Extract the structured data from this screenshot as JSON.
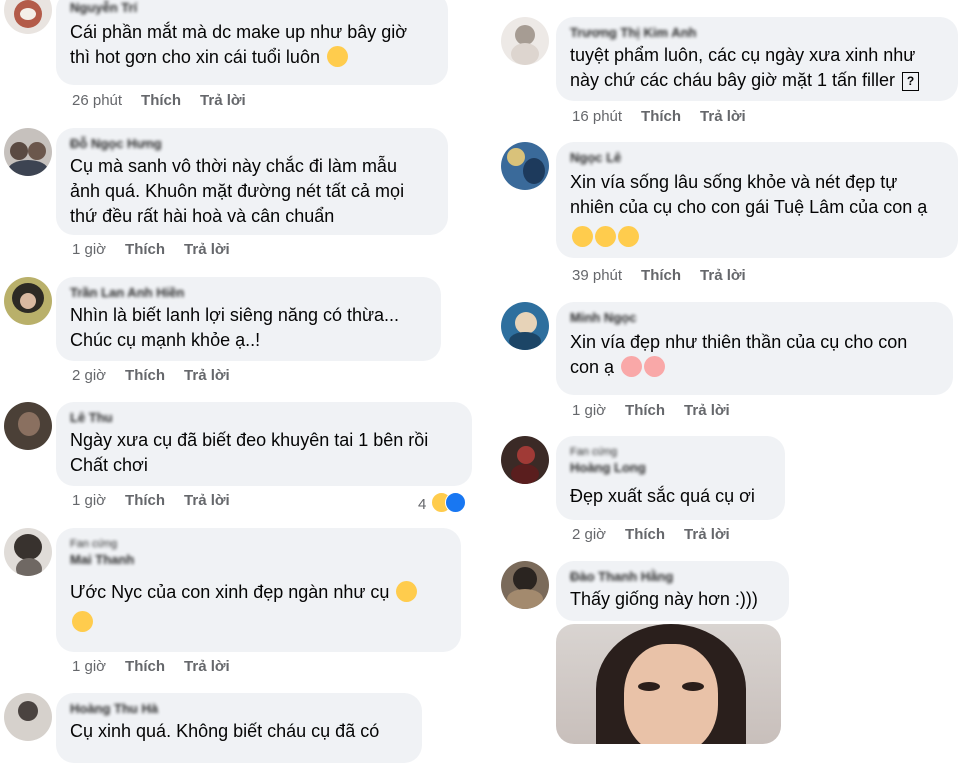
{
  "left_comments": [
    {
      "name": "Nguyễn Trí",
      "text": "Cái phần mắt mà dc make up như bây giờ\nthì hot gơn cho xin cái tuổi luôn",
      "time": "26 phút",
      "like": "Thích",
      "reply": "Trả lời"
    },
    {
      "name": "Đỗ Ngọc Hưng",
      "text": "Cụ mà sanh vô thời này chắc đi làm mẫu\nảnh quá. Khuôn mặt đường nét tất cả mọi\nthứ đều rất hài hoà và cân chuẩn",
      "time": "1 giờ",
      "like": "Thích",
      "reply": "Trả lời"
    },
    {
      "name": "Trần Lan Anh Hiền",
      "text": "Nhìn là biết lanh lợi siêng năng có thừa...\nChúc cụ mạnh khỏe ạ..!",
      "time": "2 giờ",
      "like": "Thích",
      "reply": "Trả lời"
    },
    {
      "name": "Lê Thu",
      "text": "Ngày xưa cụ đã biết đeo khuyên tai 1 bên rồi\nChất chơi",
      "time": "1 giờ",
      "like": "Thích",
      "reply": "Trả lời",
      "reaction_count": "4"
    },
    {
      "name": "Fan cứng",
      "name2": "Mai Thanh",
      "text": "Ước Nyc của con xinh đẹp ngàn như cụ",
      "time": "1 giờ",
      "like": "Thích",
      "reply": "Trả lời"
    },
    {
      "name": "Hoàng Thu Hà",
      "text": "Cụ xinh quá. Không biết cháu cụ đã có",
      "time": "",
      "like": "",
      "reply": ""
    }
  ],
  "right_comments": [
    {
      "name": "Trương Thị Kim Anh",
      "text": "tuyệt phẩm luôn, các cụ ngày xưa xinh như\nnày chứ các cháu bây giờ mặt 1 tấn filler",
      "time": "16 phút",
      "like": "Thích",
      "reply": "Trả lời"
    },
    {
      "name": "Ngọc Lê",
      "text": "Xin vía sống lâu sống khỏe và nét đẹp tự\nnhiên của cụ cho con gái Tuệ Lâm của con ạ",
      "time": "39 phút",
      "like": "Thích",
      "reply": "Trả lời"
    },
    {
      "name": "Minh Ngọc",
      "text": "Xin vía đẹp như thiên thần của cụ cho con\ncon ạ",
      "time": "1 giờ",
      "like": "Thích",
      "reply": "Trả lời"
    },
    {
      "name": "Fan cứng",
      "name2": "Hoàng Long",
      "text": "Đẹp xuất sắc quá cụ ơi",
      "time": "2 giờ",
      "like": "Thích",
      "reply": "Trả lời"
    },
    {
      "name": "Đào Thanh Hằng",
      "text": "Thấy giống này hơn :)))",
      "time": "",
      "like": "",
      "reply": ""
    }
  ],
  "colors": {
    "bubble": "#f0f2f5",
    "meta": "#65676b",
    "text": "#050505",
    "emoji": "#ffcc4d",
    "like_blue": "#1877f2"
  },
  "icons": {
    "qbox": "?"
  }
}
